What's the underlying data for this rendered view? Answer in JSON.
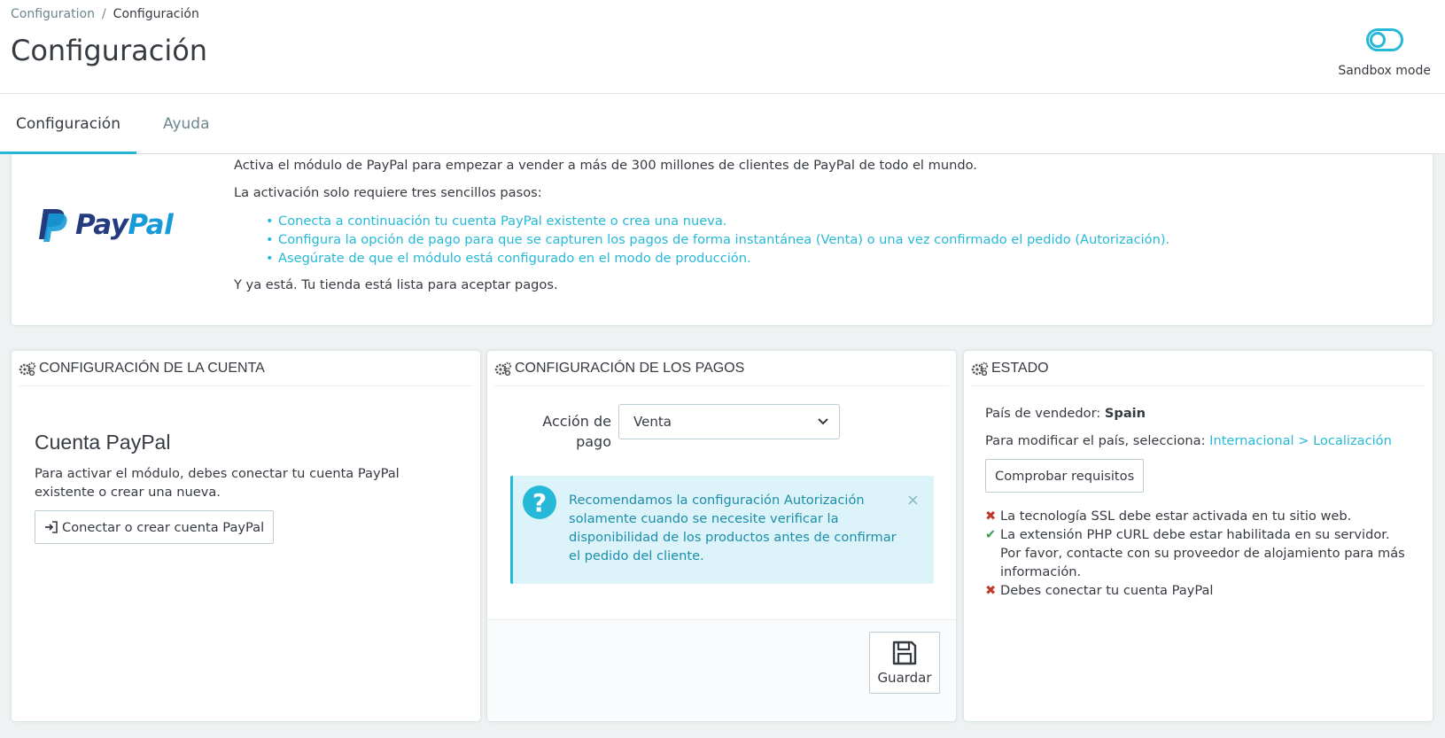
{
  "breadcrumb": {
    "parent": "Configuration",
    "separator": "/",
    "current": "Configuración"
  },
  "page_title": "Configuración",
  "sandbox": {
    "label": "Sandbox mode",
    "enabled": false
  },
  "tabs": [
    {
      "label": "Configuración",
      "active": true
    },
    {
      "label": "Ayuda",
      "active": false
    }
  ],
  "intro": {
    "logo_word_1": "Pay",
    "logo_word_2": "Pal",
    "line1": "Activa el módulo de PayPal para empezar a vender a más de 300 millones de clientes de PayPal de todo el mundo.",
    "line2": "La activación solo requiere tres sencillos pasos:",
    "steps": [
      "Conecta a continuación tu cuenta PayPal existente o crea una nueva.",
      "Configura la opción de pago para que se capturen los pagos de forma instantánea (Venta) o una vez confirmado el pedido (Autorización).",
      "Asegúrate de que el módulo está configurado en el modo de producción."
    ],
    "line3": "Y ya está. Tu tienda está lista para aceptar pagos."
  },
  "account_panel": {
    "heading": "CONFIGURACIÓN DE LA CUENTA",
    "title": "Cuenta PayPal",
    "description": "Para activar el módulo, debes conectar tu cuenta PayPal existente o crear una nueva.",
    "connect_button": "Conectar o crear cuenta PayPal"
  },
  "payments_panel": {
    "heading": "CONFIGURACIÓN DE LOS PAGOS",
    "action_label_1": "Acción de",
    "action_label_2": "pago",
    "action_value": "Venta",
    "alert": "Recomendamos la configuración Autorización solamente cuando se necesite verificar la disponibilidad de los productos antes de confirmar el pedido del cliente.",
    "alert_close": "×",
    "save_button": "Guardar"
  },
  "state_panel": {
    "heading": "ESTADO",
    "country_label": "País de vendedor:",
    "country_value": "Spain",
    "modify_label": "Para modificar el país, selecciona:",
    "modify_link": "Internacional > Localización",
    "check_button": "Comprobar requisitos",
    "requirements": [
      {
        "ok": false,
        "mark": "✖",
        "text": "La tecnología SSL debe estar activada en tu sitio web."
      },
      {
        "ok": true,
        "mark": "✔",
        "text": "La extensión PHP cURL debe estar habilitada en su servidor. Por favor, contacte con su proveedor de alojamiento para más información."
      },
      {
        "ok": false,
        "mark": "✖",
        "text": "Debes conectar tu cuenta PayPal"
      }
    ]
  },
  "colors": {
    "accent": "#25b9d7",
    "error": "#c0392b",
    "success": "#3c9c50",
    "paypal_dark": "#253b80",
    "paypal_light": "#179bd7"
  }
}
